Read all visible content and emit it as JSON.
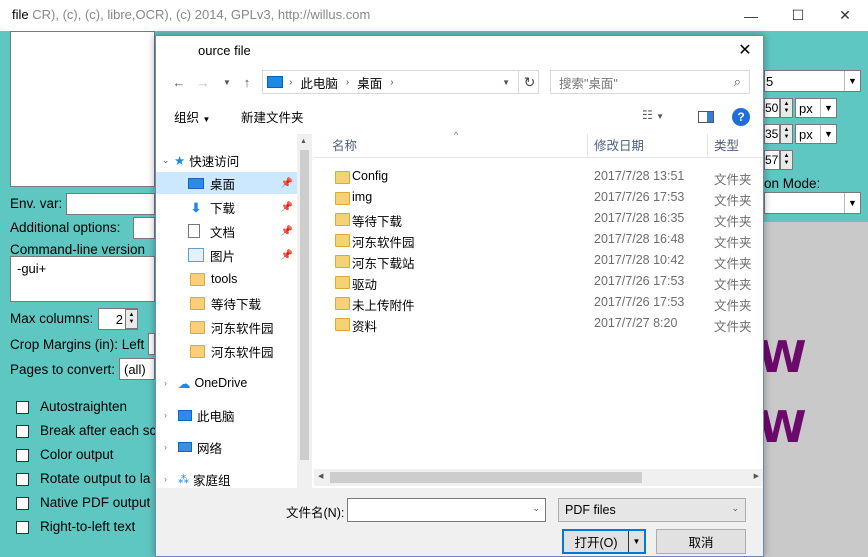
{
  "app": {
    "title_prefix": "file",
    "title_text": "(c",
    "title_file": "file",
    "title_rest": "(c",
    "title_faint": "CR), (c), (c), libre,OCR), (c) 2014, GPLv3, http://willus.com",
    "env_label": "Env. var:",
    "additional_label": "Additional options:",
    "cmdline_label": "Command-line version",
    "cmdline_value": "-gui+",
    "maxcol_label": "Max columns:",
    "maxcol_value": "2",
    "crop_label": "Crop Margins (in): Left",
    "pages_label": "Pages to convert:",
    "pages_value": "(all)",
    "checkboxes": [
      "Autostraighten",
      "Break after each sc",
      "Color output",
      "Rotate output to la",
      "Native PDF output",
      "Right-to-left text"
    ],
    "right_combo_value": "5",
    "spin1_value": "50",
    "spin1_unit": "px",
    "spin2_value": "35",
    "spin2_unit": "px",
    "spin3_value": "57",
    "mode_label": "on Mode:",
    "preview_glyph1": "W",
    "preview_glyph2": "W"
  },
  "dialog": {
    "title": "ource file",
    "close_glyph": "✕",
    "breadcrumb": [
      "此电脑",
      "桌面"
    ],
    "search_placeholder": "搜索\"桌面\"",
    "toolbar": {
      "organize": "组织",
      "new_folder": "新建文件夹"
    },
    "nav": {
      "quick_access": "快速访问",
      "pinned": [
        {
          "label": "桌面",
          "icon": "desktop-icon"
        },
        {
          "label": "下载",
          "icon": "download-icon"
        },
        {
          "label": "文档",
          "icon": "document-icon"
        },
        {
          "label": "图片",
          "icon": "picture-icon"
        }
      ],
      "folders": [
        "tools",
        "等待下载",
        "河东软件园",
        "河东软件园"
      ],
      "onedrive": "OneDrive",
      "this_pc": "此电脑",
      "network": "网络",
      "homegroup": "家庭组"
    },
    "columns": {
      "name": "名称",
      "date": "修改日期",
      "type": "类型"
    },
    "files": [
      {
        "name": "Config",
        "date": "2017/7/28 13:51",
        "type": "文件夹"
      },
      {
        "name": "img",
        "date": "2017/7/26 17:53",
        "type": "文件夹"
      },
      {
        "name": "等待下载",
        "date": "2017/7/28 16:35",
        "type": "文件夹"
      },
      {
        "name": "河东软件园",
        "date": "2017/7/28 16:48",
        "type": "文件夹"
      },
      {
        "name": "河东下载站",
        "date": "2017/7/28 10:42",
        "type": "文件夹"
      },
      {
        "name": "驱动",
        "date": "2017/7/26 17:53",
        "type": "文件夹"
      },
      {
        "name": "未上传附件",
        "date": "2017/7/26 17:53",
        "type": "文件夹"
      },
      {
        "name": "资料",
        "date": "2017/7/27 8:20",
        "type": "文件夹"
      }
    ],
    "filename_label": "文件名(N):",
    "filename_value": "",
    "filter_value": "PDF files",
    "open_label": "打开(O)",
    "cancel_label": "取消"
  }
}
